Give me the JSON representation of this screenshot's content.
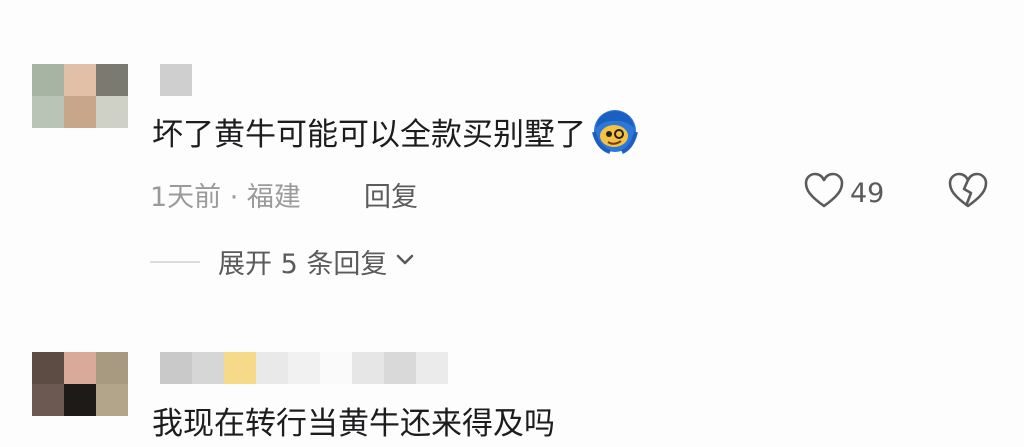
{
  "comments": [
    {
      "text": "坏了黄牛可能可以全款买别墅了",
      "emoji_icon": "blue-hair-face-emoji",
      "time_location": "1天前 · 福建",
      "reply_label": "回复",
      "likes": "49",
      "expand_label": "展开 5 条回复"
    },
    {
      "text": "我现在转行当黄牛还来得及吗"
    }
  ],
  "colors": {
    "text": "#1d1d1f",
    "meta": "#9a9a9a",
    "action": "#5b5b5b",
    "background": "#fdfdfd"
  },
  "icons": [
    "heart-outline-icon",
    "broken-heart-icon",
    "chevron-down-icon"
  ]
}
